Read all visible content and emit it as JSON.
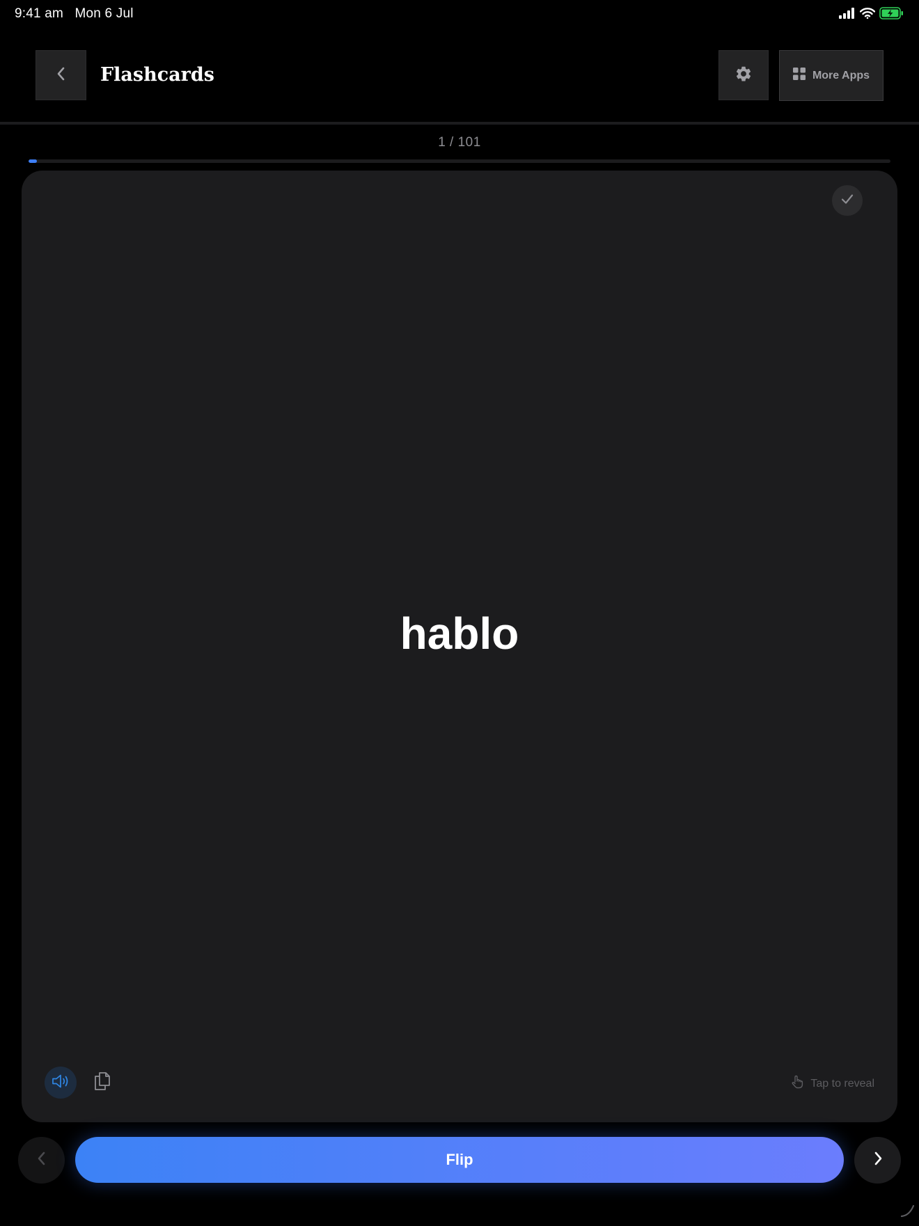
{
  "status_bar": {
    "time": "9:41 am",
    "date": "Mon 6 Jul",
    "icons": [
      "cellular-signal-icon",
      "wifi-icon",
      "battery-charging-icon"
    ],
    "battery_color": "#30d158"
  },
  "header": {
    "back_icon": "chevron-left-icon",
    "title": "Flashcards",
    "settings_icon": "gear-icon",
    "more_apps_icon": "grid-icon",
    "more_apps_label": "More Apps"
  },
  "progress": {
    "label": "1 / 101",
    "current": 1,
    "total": 101,
    "fill_fraction": 0.0099,
    "accent_color": "#3d7ef5"
  },
  "card": {
    "word": "hablo",
    "check_icon": "checkmark-icon",
    "speaker_icon": "speaker-icon",
    "copy_icon": "copy-icon",
    "tap_hint_icon": "tap-hand-icon",
    "tap_hint": "Tap to reveal"
  },
  "controls": {
    "prev_icon": "chevron-left-icon",
    "flip_label": "Flip",
    "next_icon": "chevron-right-icon"
  }
}
